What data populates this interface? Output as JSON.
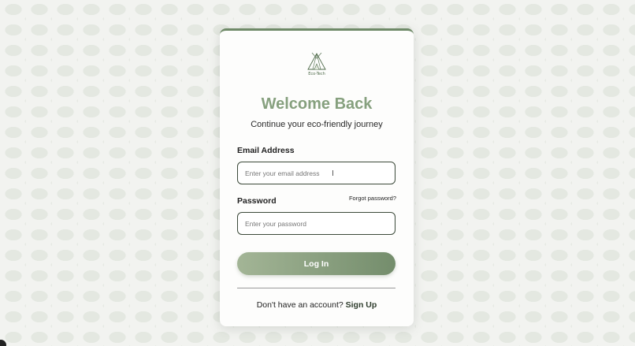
{
  "logo": {
    "icon": "eco-tech-tent-logo",
    "text": "Eco-Tech"
  },
  "login": {
    "title": "Welcome Back",
    "subtitle": "Continue your eco-friendly journey",
    "email_label": "Email Address",
    "email_placeholder": "Enter your email address",
    "email_value": "",
    "password_label": "Password",
    "forgot_password": "Forgot password?",
    "password_placeholder": "Enter your password",
    "password_value": "",
    "submit_label": "Log In",
    "signup_prompt": "Don't have an account?",
    "signup_link": "Sign Up"
  },
  "colors": {
    "accent": "#86a07e",
    "button_gradient_start": "#a3b596",
    "button_gradient_end": "#748d6c"
  }
}
